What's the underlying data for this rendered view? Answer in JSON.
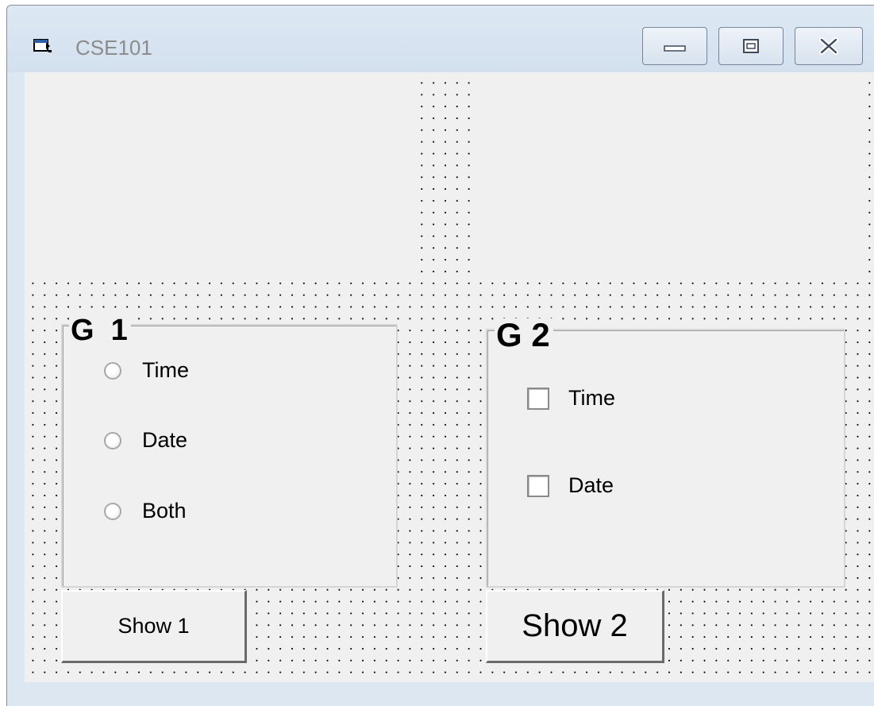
{
  "window": {
    "title": "CSE101",
    "icon": "form-window-icon",
    "controls": [
      "minimize-icon",
      "maximize-icon",
      "close-icon"
    ]
  },
  "group1": {
    "title": "G  1",
    "options": [
      {
        "label": "Time",
        "type": "radio",
        "checked": false
      },
      {
        "label": "Date",
        "type": "radio",
        "checked": false
      },
      {
        "label": "Both",
        "type": "radio",
        "checked": false
      }
    ],
    "button_label": "Show 1"
  },
  "group2": {
    "title": "G 2",
    "options": [
      {
        "label": "Time",
        "type": "checkbox",
        "checked": false
      },
      {
        "label": "Date",
        "type": "checkbox",
        "checked": false
      }
    ],
    "button_label": "Show 2"
  },
  "colors": {
    "form_background": "#f0f0f0",
    "grid_dot": "#000000",
    "title_text": "#8c8c8c"
  }
}
